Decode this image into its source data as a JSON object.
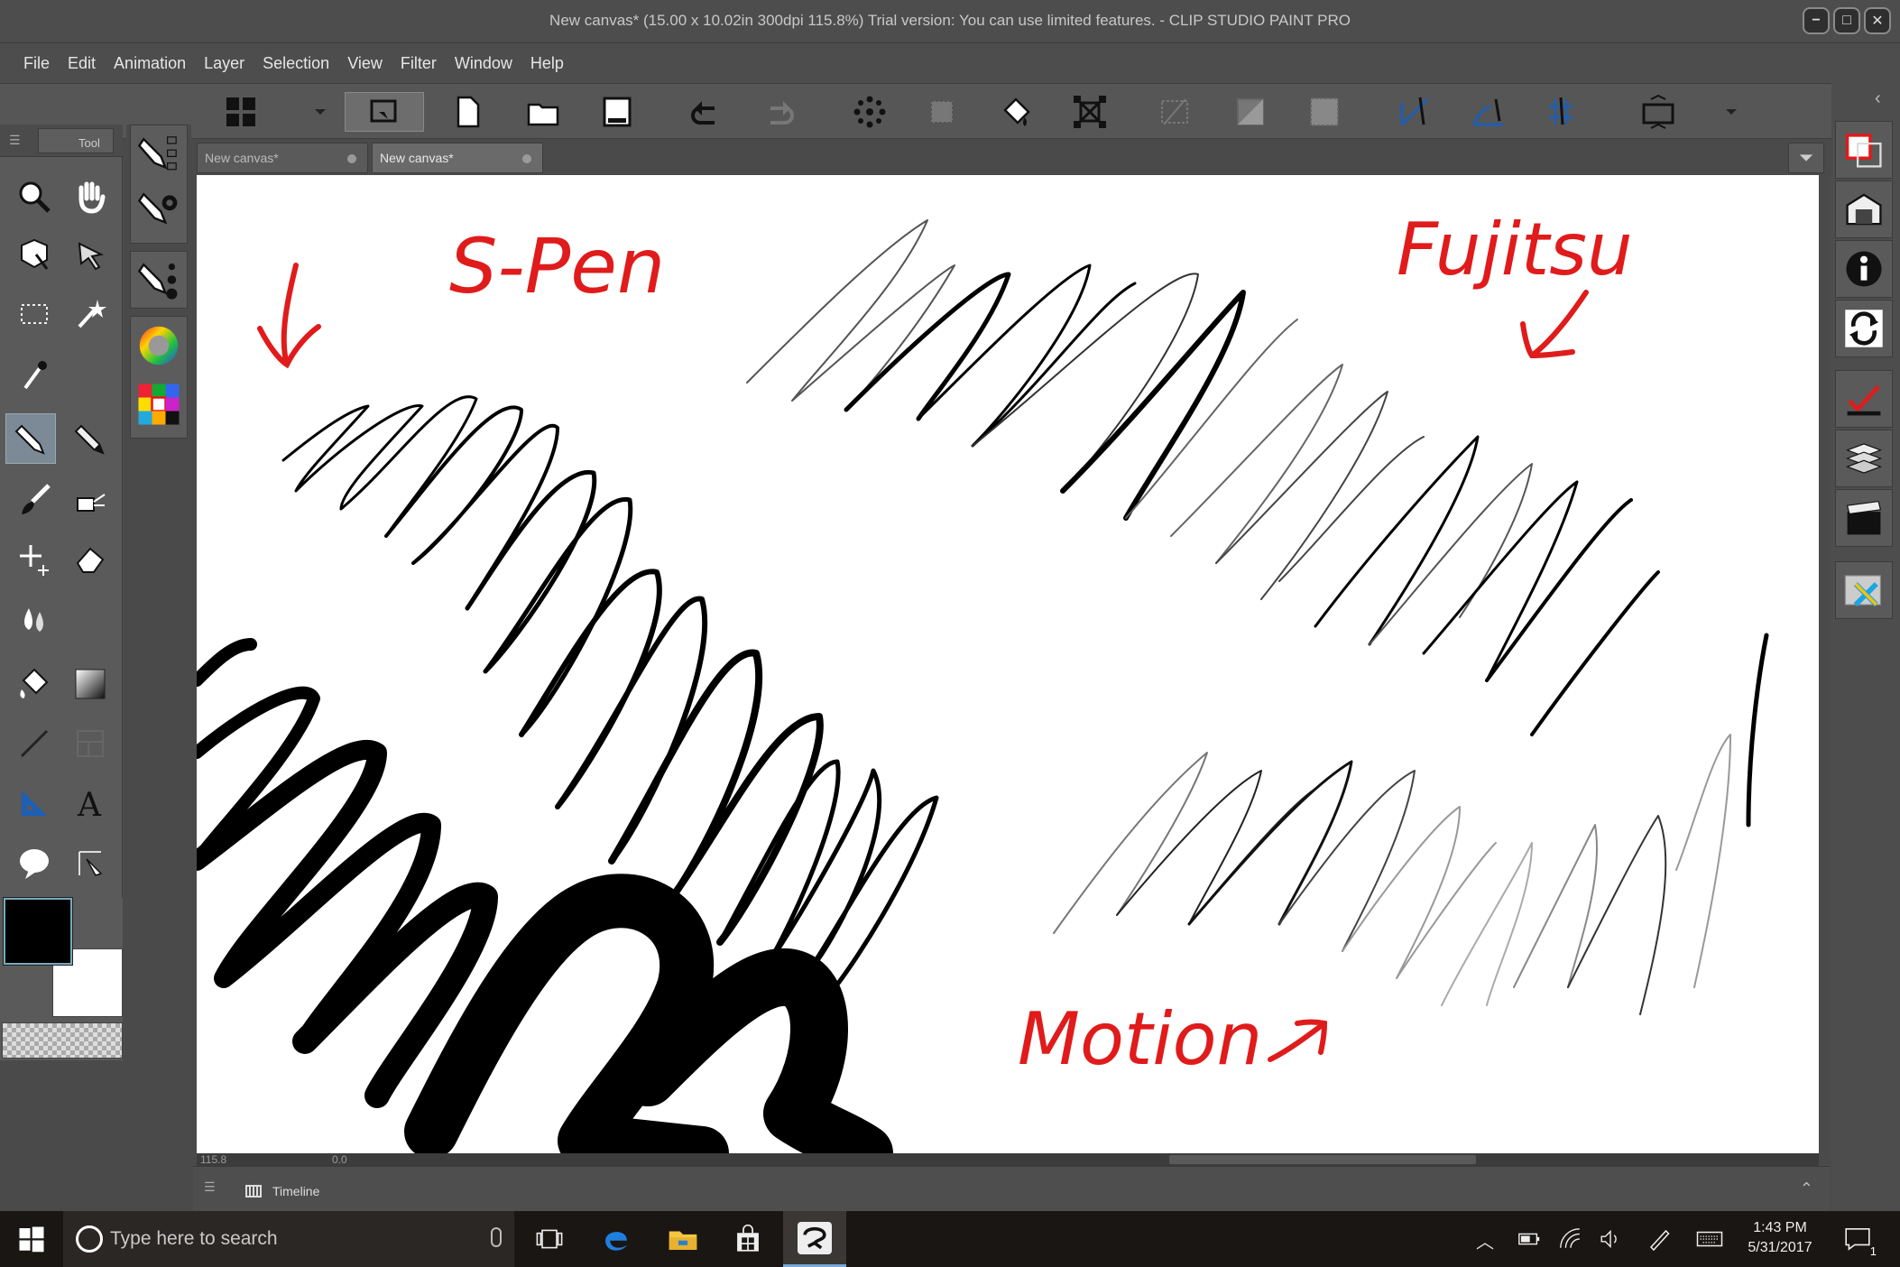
{
  "window": {
    "title": "New canvas* (15.00 x 10.02in 300dpi 115.8%)  Trial version: You can use limited features. - CLIP STUDIO PAINT PRO",
    "minimize": "−",
    "maximize": "□",
    "close": "✕"
  },
  "menu": [
    "File",
    "Edit",
    "Animation",
    "Layer",
    "Selection",
    "View",
    "Filter",
    "Window",
    "Help"
  ],
  "tool_panel": {
    "label": "Tool"
  },
  "tabs": [
    {
      "label": "New canvas*"
    },
    {
      "label": "New canvas*"
    }
  ],
  "canvas": {
    "annotations": [
      "S-Pen",
      "Fujitsu",
      "Motion"
    ]
  },
  "status": {
    "zoom": "115.8",
    "angle": "0.0"
  },
  "timeline": {
    "label": "Timeline"
  },
  "colors": {
    "main": "#000000",
    "sub": "#ffffff",
    "annotation": "#e01b1b"
  },
  "taskbar": {
    "search_placeholder": "Type here to search",
    "time": "1:43 PM",
    "date": "5/31/2017",
    "notification_count": "1"
  }
}
